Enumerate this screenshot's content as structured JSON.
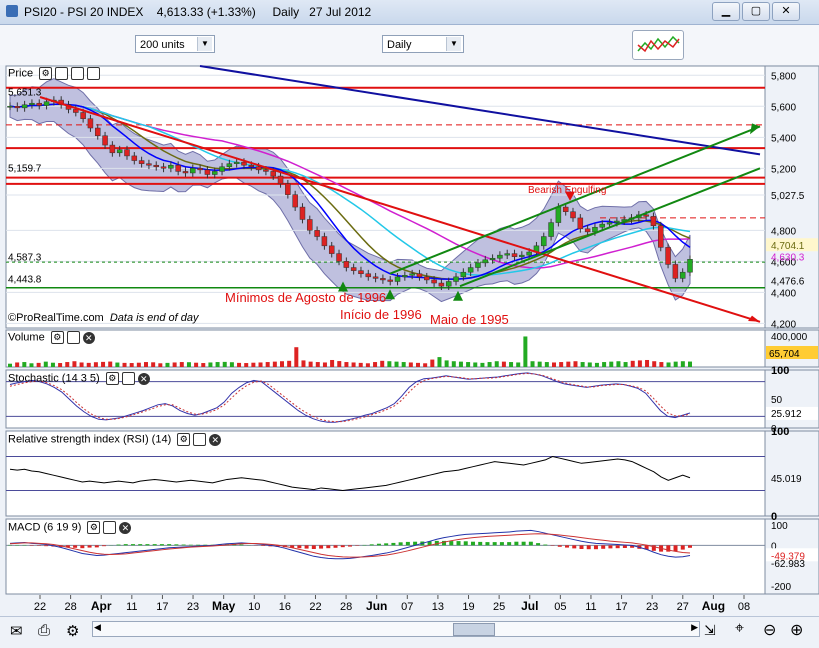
{
  "window": {
    "title_symbol": "PSI20 - PSI 20 INDEX",
    "title_price": "4,613.33 (+1.33%)",
    "title_period": "Daily",
    "title_date": "27 Jul 2012"
  },
  "toolbar": {
    "units_value": "200 units",
    "period_value": "Daily"
  },
  "panels": {
    "price_label": "Price",
    "volume_label": "Volume",
    "stochastic_label": "Stochastic (14 3 5)",
    "rsi_label": "Relative strength index (RSI) (14)",
    "macd_label": "MACD (6 19 9)",
    "source_note": "©ProRealTime.com",
    "source_note2": "Data is end of day"
  },
  "annotations": {
    "bearish": "Bearish Engulfing",
    "minimos": "Mínimos de Agosto de 1996",
    "inicio": "Início de 1996",
    "maio": "Maio de 1995"
  },
  "colors": {
    "candle_up": "#22aa22",
    "candle_down": "#dd2222",
    "bollinger_fill": "#8a8cc4",
    "resistance": "#e01010",
    "trend_blue": "#1010a0",
    "trend_green": "#118811",
    "ma_short": "#0000ff",
    "ma_long": "#000000",
    "ma_magenta": "#d020d0",
    "ma_olive": "#6b6b10",
    "cyan": "#22c8e8"
  },
  "chart_data": [
    {
      "type": "candlestick",
      "panel": "price",
      "x_tick_labels": [
        "22",
        "28",
        "Apr",
        "11",
        "17",
        "23",
        "May",
        "10",
        "16",
        "22",
        "28",
        "Jun",
        "07",
        "13",
        "19",
        "25",
        "Jul",
        "05",
        "11",
        "17",
        "23",
        "27",
        "Aug",
        "08"
      ],
      "y_tick_labels": [
        "5,800",
        "5,600",
        "5,400",
        "5,200",
        "5,027.5",
        "4,800",
        "4,600",
        "4,400",
        "4,200"
      ],
      "ylim": [
        4170,
        5860
      ],
      "price_line_labels_left": [
        "5,651.3",
        "5,159.7",
        "4,587.3",
        "4,443.8"
      ],
      "price_line_values_left": [
        5651.3,
        5159.7,
        4587.3,
        4443.8
      ],
      "right_value_labels": [
        "4,704.1",
        "4,630.3",
        "4,476.6"
      ],
      "closes": [
        5600,
        5590,
        5610,
        5620,
        5605,
        5630,
        5640,
        5610,
        5580,
        5560,
        5520,
        5460,
        5410,
        5350,
        5300,
        5320,
        5280,
        5250,
        5230,
        5220,
        5210,
        5200,
        5220,
        5180,
        5170,
        5200,
        5190,
        5160,
        5180,
        5210,
        5230,
        5240,
        5220,
        5210,
        5190,
        5180,
        5150,
        5100,
        5030,
        4950,
        4870,
        4800,
        4760,
        4700,
        4650,
        4600,
        4560,
        4540,
        4520,
        4500,
        4490,
        4480,
        4470,
        4500,
        4510,
        4520,
        4500,
        4480,
        4460,
        4440,
        4470,
        4500,
        4530,
        4560,
        4590,
        4610,
        4620,
        4640,
        4650,
        4630,
        4640,
        4660,
        4700,
        4760,
        4850,
        4950,
        4920,
        4880,
        4810,
        4790,
        4820,
        4840,
        4850,
        4860,
        4870,
        4880,
        4900,
        4890,
        4830,
        4690,
        4580,
        4490,
        4530,
        4613
      ]
    },
    {
      "type": "bar",
      "panel": "volume",
      "y_tick_labels": [
        "400,000"
      ],
      "current_label": "65,704",
      "values": [
        40,
        55,
        60,
        45,
        50,
        65,
        52,
        48,
        60,
        70,
        55,
        50,
        58,
        62,
        66,
        54,
        50,
        48,
        52,
        60,
        57,
        45,
        50,
        55,
        60,
        58,
        52,
        48,
        55,
        60,
        62,
        58,
        50,
        48,
        52,
        55,
        60,
        65,
        70,
        75,
        240,
        80,
        65,
        60,
        55,
        85,
        72,
        60,
        55,
        50,
        45,
        60,
        75,
        70,
        65,
        60,
        55,
        50,
        45,
        90,
        120,
        80,
        70,
        65,
        60,
        55,
        50,
        60,
        70,
        65,
        60,
        55,
        370,
        70,
        65,
        60,
        55,
        60,
        65,
        70,
        60,
        55,
        50,
        60,
        65,
        70,
        60,
        75,
        80,
        85,
        70,
        60,
        55,
        65,
        70,
        66
      ]
    },
    {
      "type": "line",
      "panel": "stochastic",
      "y_tick_labels": [
        "100",
        "50",
        "0"
      ],
      "current_label": "25.912",
      "ylim": [
        0,
        100
      ],
      "series": [
        {
          "values": [
            75,
            78,
            80,
            82,
            80,
            76,
            70,
            62,
            50,
            38,
            28,
            20,
            15,
            14,
            16,
            18,
            22,
            26,
            30,
            35,
            40,
            42,
            38,
            30,
            25,
            22,
            25,
            30,
            35,
            45,
            60,
            70,
            78,
            82,
            80,
            70,
            60,
            50,
            40,
            30,
            22,
            16,
            12,
            10,
            10,
            12,
            15,
            18,
            22,
            25,
            30,
            35,
            42,
            55,
            70,
            80,
            85,
            86,
            88,
            90,
            88,
            86,
            84,
            85,
            86,
            87,
            88,
            90,
            92,
            94,
            95,
            93,
            90,
            85,
            80,
            76,
            74,
            72,
            70,
            72,
            74,
            75,
            76,
            75,
            72,
            68,
            60,
            45,
            30,
            20,
            18,
            22,
            26
          ]
        },
        {
          "values": [
            72,
            75,
            78,
            80,
            81,
            78,
            73,
            66,
            56,
            44,
            33,
            24,
            18,
            15,
            15,
            17,
            20,
            24,
            28,
            32,
            37,
            40,
            40,
            34,
            28,
            24,
            24,
            27,
            32,
            40,
            52,
            64,
            73,
            79,
            81,
            75,
            65,
            55,
            45,
            35,
            27,
            20,
            15,
            12,
            11,
            11,
            13,
            16,
            19,
            23,
            27,
            32,
            38,
            48,
            62,
            74,
            82,
            85,
            87,
            89,
            88,
            87,
            85,
            85,
            86,
            86,
            87,
            89,
            91,
            93,
            94,
            93,
            91,
            87,
            82,
            78,
            75,
            73,
            71,
            71,
            73,
            74,
            75,
            75,
            73,
            70,
            64,
            52,
            38,
            26,
            21,
            21,
            24
          ]
        }
      ]
    },
    {
      "type": "line",
      "panel": "rsi",
      "y_tick_labels": [
        "100",
        "0"
      ],
      "current_label": "45.019",
      "ylim": [
        0,
        100
      ],
      "values": [
        55,
        54,
        55,
        53,
        52,
        50,
        48,
        46,
        44,
        42,
        40,
        41,
        40,
        39,
        40,
        41,
        40,
        39,
        41,
        42,
        43,
        42,
        41,
        40,
        41,
        42,
        41,
        40,
        39,
        41,
        43,
        44,
        45,
        44,
        43,
        42,
        40,
        38,
        36,
        34,
        33,
        32,
        31,
        33,
        32,
        31,
        30,
        31,
        32,
        33,
        34,
        35,
        36,
        38,
        40,
        42,
        44,
        46,
        48,
        50,
        52,
        53,
        54,
        56,
        58,
        60,
        62,
        64,
        63,
        62,
        61,
        60,
        62,
        64,
        66,
        70,
        68,
        66,
        64,
        62,
        63,
        64,
        65,
        66,
        67,
        66,
        64,
        60,
        56,
        52,
        46,
        42,
        45,
        48,
        45
      ]
    },
    {
      "type": "bar",
      "panel": "macd",
      "y_tick_labels": [
        "100",
        "0",
        "-200"
      ],
      "current_labels": [
        "-49.379",
        "-62.983"
      ],
      "ylim": [
        -240,
        130
      ],
      "values": [
        10,
        12,
        14,
        10,
        8,
        4,
        -2,
        -10,
        -20,
        -30,
        -40,
        -45,
        -50,
        -48,
        -44,
        -40,
        -36,
        -32,
        -28,
        -24,
        -20,
        -16,
        -12,
        -10,
        -8,
        -6,
        -4,
        -2,
        0,
        4,
        8,
        10,
        12,
        10,
        8,
        4,
        0,
        -6,
        -14,
        -24,
        -34,
        -44,
        -54,
        -60,
        -64,
        -66,
        -66,
        -64,
        -60,
        -55,
        -50,
        -44,
        -38,
        -30,
        -20,
        -10,
        0,
        10,
        20,
        30,
        38,
        44,
        50,
        54,
        56,
        58,
        60,
        62,
        64,
        66,
        70,
        72,
        74,
        68,
        60,
        52,
        44,
        36,
        28,
        20,
        14,
        10,
        8,
        6,
        4,
        2,
        0,
        -10,
        -20,
        -34,
        -46,
        -54,
        -58,
        -56,
        -50
      ],
      "signal": [
        8,
        10,
        12,
        12,
        10,
        8,
        4,
        -2,
        -10,
        -18,
        -26,
        -34,
        -40,
        -44,
        -45,
        -44,
        -42,
        -38,
        -34,
        -30,
        -26,
        -22,
        -18,
        -15,
        -12,
        -9,
        -7,
        -5,
        -3,
        -1,
        2,
        5,
        8,
        9,
        9,
        7,
        5,
        1,
        -5,
        -12,
        -20,
        -28,
        -36,
        -44,
        -50,
        -54,
        -57,
        -58,
        -58,
        -57,
        -55,
        -52,
        -48,
        -42,
        -35,
        -27,
        -18,
        -9,
        0,
        8,
        16,
        23,
        29,
        34,
        38,
        41,
        44,
        46,
        48,
        50,
        52,
        54,
        56,
        57,
        56,
        54,
        51,
        47,
        43,
        38,
        33,
        29,
        25,
        21,
        18,
        15,
        12,
        7,
        1,
        -7,
        -15,
        -23,
        -30,
        -35,
        -38
      ]
    }
  ]
}
